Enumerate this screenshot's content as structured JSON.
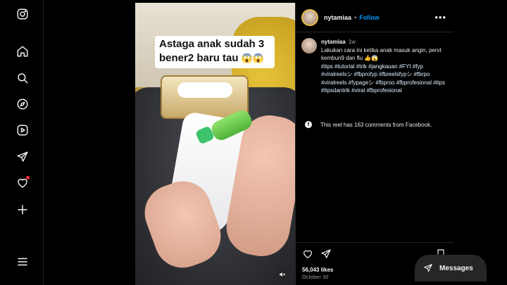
{
  "nav": {
    "items": [
      {
        "name": "instagram-logo-icon"
      },
      {
        "name": "home-icon"
      },
      {
        "name": "search-icon"
      },
      {
        "name": "explore-icon"
      },
      {
        "name": "reels-icon"
      },
      {
        "name": "messages-icon"
      },
      {
        "name": "notifications-icon"
      },
      {
        "name": "create-icon"
      },
      {
        "name": "more-menu-icon"
      }
    ]
  },
  "post": {
    "overlay_line1": "Astaga anak sudah 3",
    "overlay_line2": "bener2 baru tau",
    "overlay_emoji": "😱😱",
    "author": "nytamiaa",
    "separator": "•",
    "follow_label": "Follow",
    "more_label": "•••",
    "caption_time": "1w",
    "caption_text": "Lakukan cara ini ketika anak masuk angin, pervt kembun9 dan flu 👍😱",
    "hashtags": "#tips #tutorial #trik #jangkauan #FYI #fyp #viralreelsシ #fbprofyp #fbreelsfypシ #fbrpo #viralreels #fypageシ #fbproo #fbprofesional #tips #tipsdantrik #viral #fbprofesional",
    "facebook_note": "This reel has 163 comments from Facebook.",
    "likes": "56,043 likes",
    "date": "October 30"
  },
  "messages_button": {
    "label": "Messages"
  },
  "colors": {
    "accent": "#0095f6",
    "background": "#000000",
    "panel": "#262626",
    "notification_dot": "#ff3040"
  }
}
